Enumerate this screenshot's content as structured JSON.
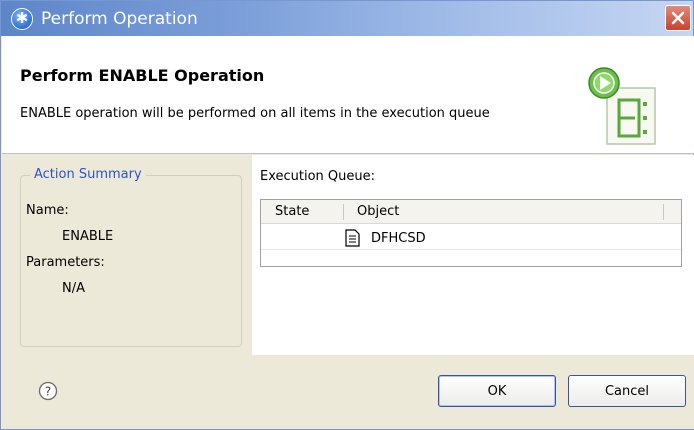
{
  "window": {
    "title": "Perform Operation",
    "title_icon": "asterisk-icon",
    "close_icon": "close-icon"
  },
  "banner": {
    "title": "Perform ENABLE Operation",
    "description": "ENABLE operation will be performed on all items in the execution queue",
    "graphic": "execute-queue-graphic"
  },
  "summary": {
    "legend": "Action Summary",
    "name_label": "Name:",
    "name_value": "ENABLE",
    "parameters_label": "Parameters:",
    "parameters_value": "N/A"
  },
  "queue": {
    "label": "Execution Queue:",
    "columns": [
      "State",
      "Object"
    ],
    "rows": [
      {
        "state": "",
        "object": "DFHCSD",
        "icon": "document-icon"
      }
    ]
  },
  "footer": {
    "help_icon": "help-icon",
    "ok_label": "OK",
    "cancel_label": "Cancel"
  },
  "colors": {
    "title_gradient_start": "#5d86c8",
    "legend_text": "#2b55c6",
    "close_button": "#c9412d",
    "dialog_bg": "#ece9d8"
  }
}
